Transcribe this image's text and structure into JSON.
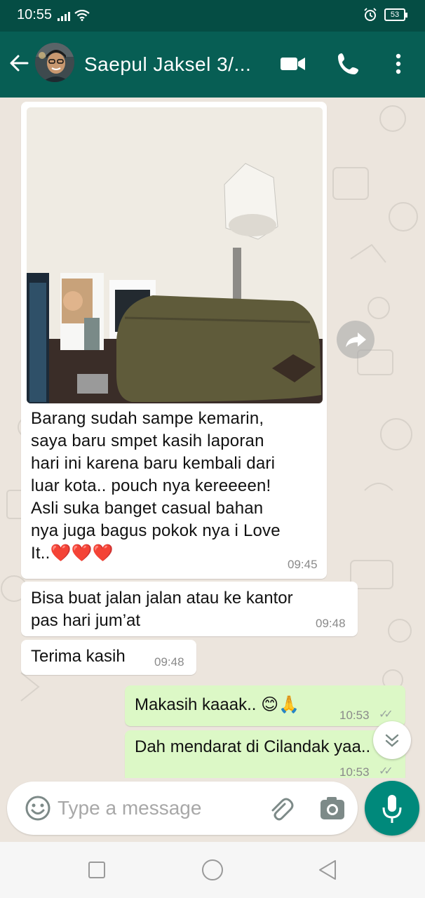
{
  "status_bar": {
    "time": "10:55",
    "battery": "53"
  },
  "header": {
    "contact_name": "Saepul Jaksel 3/..."
  },
  "messages": [
    {
      "direction": "in",
      "type": "image",
      "caption": "Barang sudah sampe kemarin,\nsaya baru smpet kasih laporan\nhari ini karena baru kembali dari\nluar kota.. pouch nya kereeeen!\nAsli suka banget casual bahan\nnya juga bagus pokok nya i Love\nIt..❤️❤️❤️",
      "time": "09:45"
    },
    {
      "direction": "in",
      "text": "Bisa buat jalan jalan atau ke kantor\npas hari jum’at",
      "time": "09:48"
    },
    {
      "direction": "in",
      "text": "Terima kasih",
      "time": "09:48"
    },
    {
      "direction": "out",
      "text": "Makasih kaaak.. 😊🙏",
      "time": "10:53"
    },
    {
      "direction": "out",
      "text": "Dah mendarat di Cilandak yaa..",
      "time": "10:53"
    }
  ],
  "composer": {
    "placeholder": "Type a message"
  },
  "colors": {
    "header": "#075e54",
    "status_bar": "#054d44",
    "outgoing_bubble": "#dcf8c6",
    "incoming_bubble": "#ffffff",
    "mic_button": "#00897b",
    "chat_background": "#ece5dd"
  },
  "icons": [
    "back-arrow-icon",
    "video-call-icon",
    "phone-icon",
    "more-menu-icon",
    "forward-icon",
    "scroll-down-icon",
    "emoji-icon",
    "attach-icon",
    "camera-icon",
    "mic-icon",
    "nav-recents-icon",
    "nav-home-icon",
    "nav-back-icon"
  ]
}
